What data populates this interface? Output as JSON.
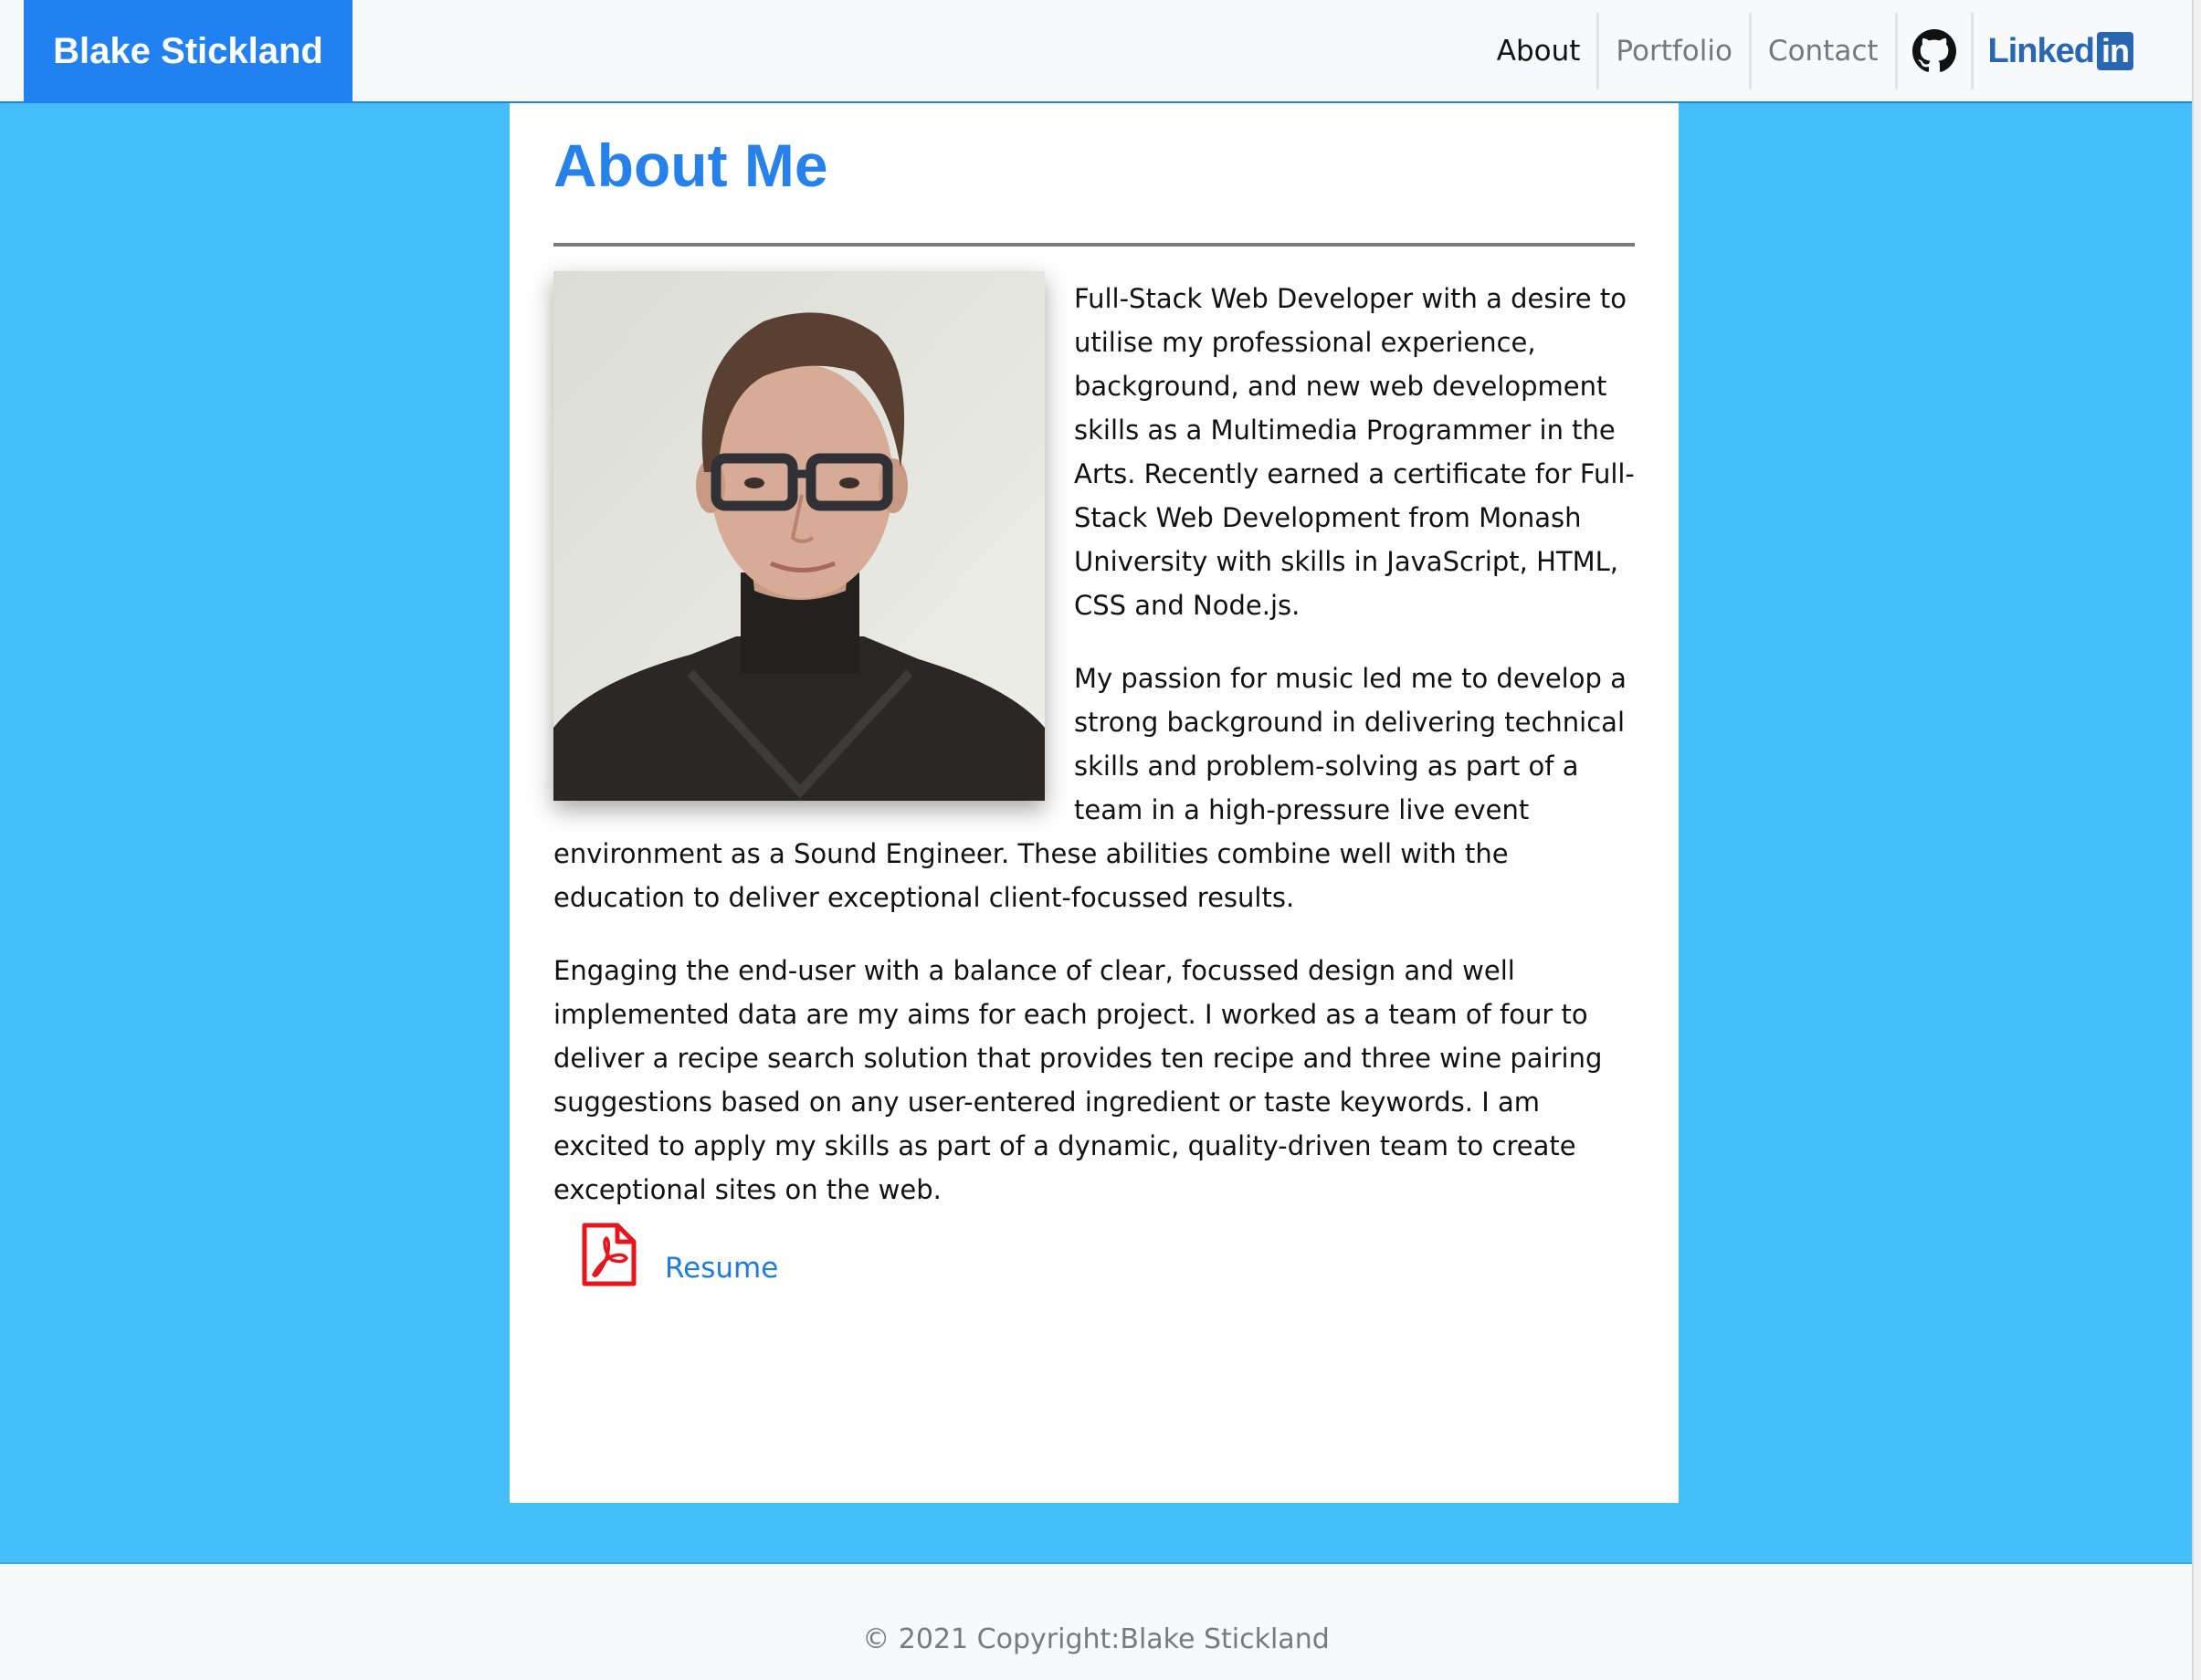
{
  "navbar": {
    "brand": "Blake Stickland",
    "links": [
      {
        "label": "About",
        "active": true
      },
      {
        "label": "Portfolio",
        "active": false
      },
      {
        "label": "Contact",
        "active": false
      }
    ],
    "github_icon": "github-icon",
    "linkedin": {
      "word": "Linked",
      "box": "in",
      "icon": "linkedin-logo"
    }
  },
  "about": {
    "title": "About Me",
    "paragraphs": [
      "Full-Stack Web Developer with a desire to utilise my professional experience, background, and new web development skills as a Multimedia Programmer in the Arts. Recently earned a certificate for Full-Stack Web Development from Monash University with skills in JavaScript, HTML, CSS and Node.js.",
      "My passion for music led me to develop a strong background in delivering technical skills and problem-solving as part of a team in a high-pressure live event environment as a Sound Engineer. These abilities combine well with the education to deliver exceptional client-focussed results.",
      "Engaging the end-user with a balance of clear, focussed design and well implemented data are my aims for each project. I worked as a team of four to deliver a recipe search solution that provides ten recipe and three wine pairing suggestions based on any user-entered ingredient or taste keywords. I am excited to apply my skills as part of a dynamic, quality-driven team to create exceptional sites on the web."
    ],
    "resume_label": "Resume",
    "resume_icon": "pdf-icon"
  },
  "footer": {
    "text": "© 2021 Copyright:Blake Stickland"
  },
  "colors": {
    "brand_bg": "#2281f0",
    "page_bg": "#44bff9",
    "title": "#2781ea",
    "link": "#1e7be0",
    "pdf_red": "#e8141c"
  }
}
